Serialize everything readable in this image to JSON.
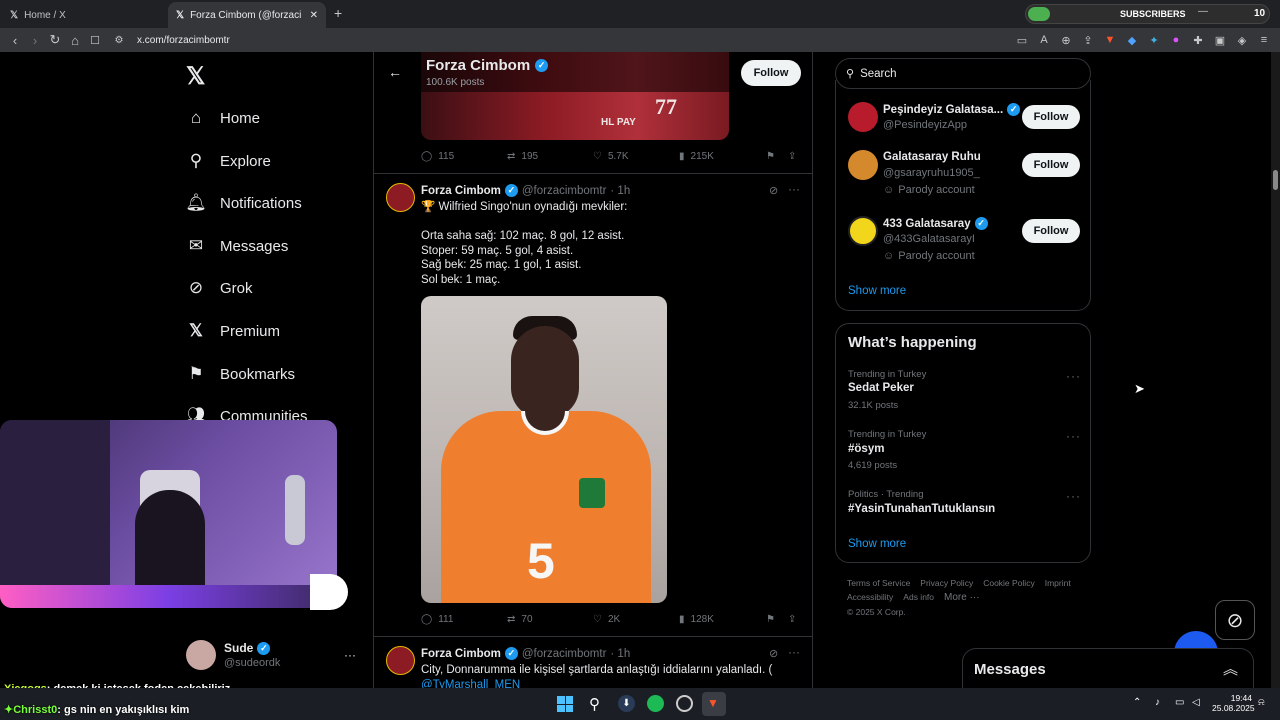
{
  "browser": {
    "tabs": [
      {
        "title": "Home / X"
      },
      {
        "title": "Forza Cimbom (@forzacimbomtr"
      }
    ],
    "new_tab": "+",
    "url": "x.com/forzacimbomtr",
    "subscribers_label": "SUBSCRIBERS",
    "subscribers_count": "10"
  },
  "sidebar": {
    "logo": "x-logo",
    "items": [
      {
        "label": "Home",
        "icon": "home-icon"
      },
      {
        "label": "Explore",
        "icon": "search-icon"
      },
      {
        "label": "Notifications",
        "icon": "bell-icon"
      },
      {
        "label": "Messages",
        "icon": "envelope-icon"
      },
      {
        "label": "Grok",
        "icon": "grok-icon"
      },
      {
        "label": "Premium",
        "icon": "x-icon"
      },
      {
        "label": "Bookmarks",
        "icon": "bookmark-icon"
      },
      {
        "label": "Communities",
        "icon": "people-icon"
      }
    ],
    "account": {
      "name": "Sude",
      "handle": "@sudeordk",
      "more": "···"
    }
  },
  "profile_header": {
    "name": "Forza Cimbom",
    "posts": "100.6K posts",
    "follow_label": "Follow",
    "banner_text": "HL PAY"
  },
  "tweets": [
    {
      "stats": {
        "replies": "115",
        "reposts": "195",
        "likes": "5.7K",
        "views": "215K"
      }
    },
    {
      "name": "Forza Cimbom",
      "handle": "@forzacimbomtr",
      "time": "· 1h",
      "lines": [
        "🏆 Wilfried Singo'nun oynadığı mevkiler:",
        "",
        "Orta saha sağ: 102 maç. 8 gol, 12 asist.",
        "Stoper: 59 maç. 5 gol, 4 asist.",
        "Sağ bek: 25 maç. 1 gol, 1 asist.",
        "Sol bek: 1 maç."
      ],
      "jersey_number": "5",
      "stats": {
        "replies": "111",
        "reposts": "70",
        "likes": "2K",
        "views": "128K"
      }
    },
    {
      "name": "Forza Cimbom",
      "handle": "@forzacimbomtr",
      "time": "· 1h",
      "lines": [
        "City, Donnarumma ile kişisel şartlarda anlaştığı iddialarını yalanladı. ("
      ],
      "link": "@TyMarshall_MEN"
    }
  ],
  "search": {
    "placeholder": "Search"
  },
  "who_to_follow": {
    "items": [
      {
        "name": "Peşindeyiz Galatasa...",
        "handle": "@PesindeyizApp",
        "follow": "Follow"
      },
      {
        "name": "Galatasaray Ruhu",
        "handle": "@gsarayruhu1905_",
        "badge": "Parody account",
        "follow": "Follow"
      },
      {
        "name": "433 Galatasaray",
        "handle": "@433GalatasarayI",
        "badge": "Parody account",
        "follow": "Follow"
      }
    ],
    "show_more": "Show more"
  },
  "whats_happening": {
    "title": "What’s happening",
    "trends": [
      {
        "meta": "Trending in Turkey",
        "title": "Sedat Peker",
        "posts": "32.1K posts"
      },
      {
        "meta": "Trending in Turkey",
        "title": "#ösym",
        "posts": "4,619 posts"
      },
      {
        "meta": "Politics · Trending",
        "title": "#YasinTunahanTutuklansın",
        "posts": ""
      }
    ],
    "show_more": "Show more"
  },
  "footer": {
    "links": [
      "Terms of Service",
      "Privacy Policy",
      "Cookie Policy",
      "Imprint",
      "Accessibility",
      "Ads info",
      "More ···"
    ],
    "copyright": "© 2025 X Corp."
  },
  "messages_drawer": {
    "title": "Messages"
  },
  "chat_overlay": [
    {
      "user": "Xiegogs",
      "text": ": demek ki istesek foden çekebiliriz"
    },
    {
      "user": "Chrisst0",
      "text": ": gs nin en yakışıklısı kim"
    }
  ],
  "taskbar": {
    "time": "19:44",
    "date": "25.08.2025"
  },
  "colors": {
    "accent": "#1d9bf0",
    "background": "#000000",
    "border": "#2f3336",
    "muted": "#71767b"
  }
}
